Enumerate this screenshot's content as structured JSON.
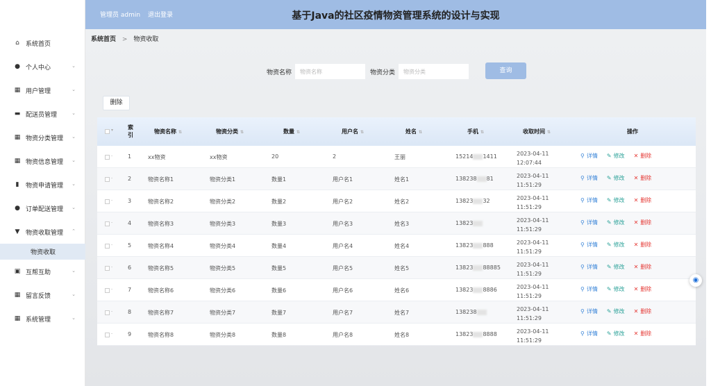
{
  "header": {
    "user_label": "管理员 admin",
    "logout_label": "退出登录",
    "title": "基于Java的社区疫情物资管理系统的设计与实现"
  },
  "sidebar": {
    "items": [
      {
        "label": "系统首页",
        "icon": "home-icon",
        "glyph": "⌂"
      },
      {
        "label": "个人中心",
        "icon": "user-icon",
        "glyph": "●",
        "arrow": "⌄"
      },
      {
        "label": "用户管理",
        "icon": "grid-icon",
        "glyph": "▦",
        "arrow": "⌄"
      },
      {
        "label": "配送员管理",
        "icon": "monitor-icon",
        "glyph": "▬",
        "arrow": "⌄"
      },
      {
        "label": "物资分类管理",
        "icon": "grid-icon",
        "glyph": "▦",
        "arrow": "⌄"
      },
      {
        "label": "物资信息管理",
        "icon": "grid-icon",
        "glyph": "▦",
        "arrow": "⌄"
      },
      {
        "label": "物资申请管理",
        "icon": "chart-icon",
        "glyph": "▮",
        "arrow": "⌄"
      },
      {
        "label": "订单配送管理",
        "icon": "user-icon",
        "glyph": "●",
        "arrow": "⌄"
      },
      {
        "label": "物资收取管理",
        "icon": "trophy-icon",
        "glyph": "▼",
        "arrow": "⌃"
      },
      {
        "label": "互帮互助",
        "icon": "calendar-icon",
        "glyph": "▣",
        "arrow": "⌄"
      },
      {
        "label": "留言反馈",
        "icon": "grid-icon",
        "glyph": "▦",
        "arrow": "⌄"
      },
      {
        "label": "系统管理",
        "icon": "grid-icon",
        "glyph": "▦",
        "arrow": "⌄"
      }
    ],
    "sub_item": "物资收取"
  },
  "breadcrumb": {
    "home": "系统首页",
    "separator": ">",
    "current": "物资收取"
  },
  "search": {
    "name_label": "物资名称",
    "name_placeholder": "物资名称",
    "category_label": "物资分类",
    "category_placeholder": "物资分类",
    "query_label": "查询"
  },
  "toolbar": {
    "delete_label": "删除"
  },
  "table": {
    "headers": {
      "index": "索引",
      "name": "物资名称",
      "category": "物资分类",
      "quantity": "数量",
      "username": "用户名",
      "realname": "姓名",
      "phone": "手机",
      "time": "收取时间",
      "ops": "操作"
    },
    "ops": {
      "detail": "详情",
      "edit": "修改",
      "delete": "删除"
    },
    "rows": [
      {
        "index": "1",
        "name": "xx物资",
        "category": "xx物资",
        "quantity": "20",
        "username": "2",
        "realname": "王丽",
        "phone_a": "15214",
        "phone_b": "1411",
        "time": "2023-04-11 12:07:44"
      },
      {
        "index": "2",
        "name": "物资名称1",
        "category": "物资分类1",
        "quantity": "数量1",
        "username": "用户名1",
        "realname": "姓名1",
        "phone_a": "138238",
        "phone_b": "81",
        "time": "2023-04-11 11:51:29"
      },
      {
        "index": "3",
        "name": "物资名称2",
        "category": "物资分类2",
        "quantity": "数量2",
        "username": "用户名2",
        "realname": "姓名2",
        "phone_a": "13823",
        "phone_b": "32",
        "time": "2023-04-11 11:51:29"
      },
      {
        "index": "4",
        "name": "物资名称3",
        "category": "物资分类3",
        "quantity": "数量3",
        "username": "用户名3",
        "realname": "姓名3",
        "phone_a": "13823",
        "phone_b": "",
        "time": "2023-04-11 11:51:29"
      },
      {
        "index": "5",
        "name": "物资名称4",
        "category": "物资分类4",
        "quantity": "数量4",
        "username": "用户名4",
        "realname": "姓名4",
        "phone_a": "13823",
        "phone_b": "888",
        "time": "2023-04-11 11:51:29"
      },
      {
        "index": "6",
        "name": "物资名称5",
        "category": "物资分类5",
        "quantity": "数量5",
        "username": "用户名5",
        "realname": "姓名5",
        "phone_a": "13823",
        "phone_b": "88885",
        "time": "2023-04-11 11:51:29"
      },
      {
        "index": "7",
        "name": "物资名称6",
        "category": "物资分类6",
        "quantity": "数量6",
        "username": "用户名6",
        "realname": "姓名6",
        "phone_a": "13823",
        "phone_b": "8886",
        "time": "2023-04-11 11:51:29"
      },
      {
        "index": "8",
        "name": "物资名称7",
        "category": "物资分类7",
        "quantity": "数量7",
        "username": "用户名7",
        "realname": "姓名7",
        "phone_a": "138238",
        "phone_b": "",
        "time": "2023-04-11 11:51:29"
      },
      {
        "index": "9",
        "name": "物资名称8",
        "category": "物资分类8",
        "quantity": "数量8",
        "username": "用户名8",
        "realname": "姓名8",
        "phone_a": "13823",
        "phone_b": "8888",
        "time": "2023-04-11 11:51:29"
      }
    ]
  },
  "colors": {
    "header_bg": "#9fbce4",
    "detail": "#3a85d8",
    "edit": "#2aa198",
    "delete": "#e53935"
  }
}
